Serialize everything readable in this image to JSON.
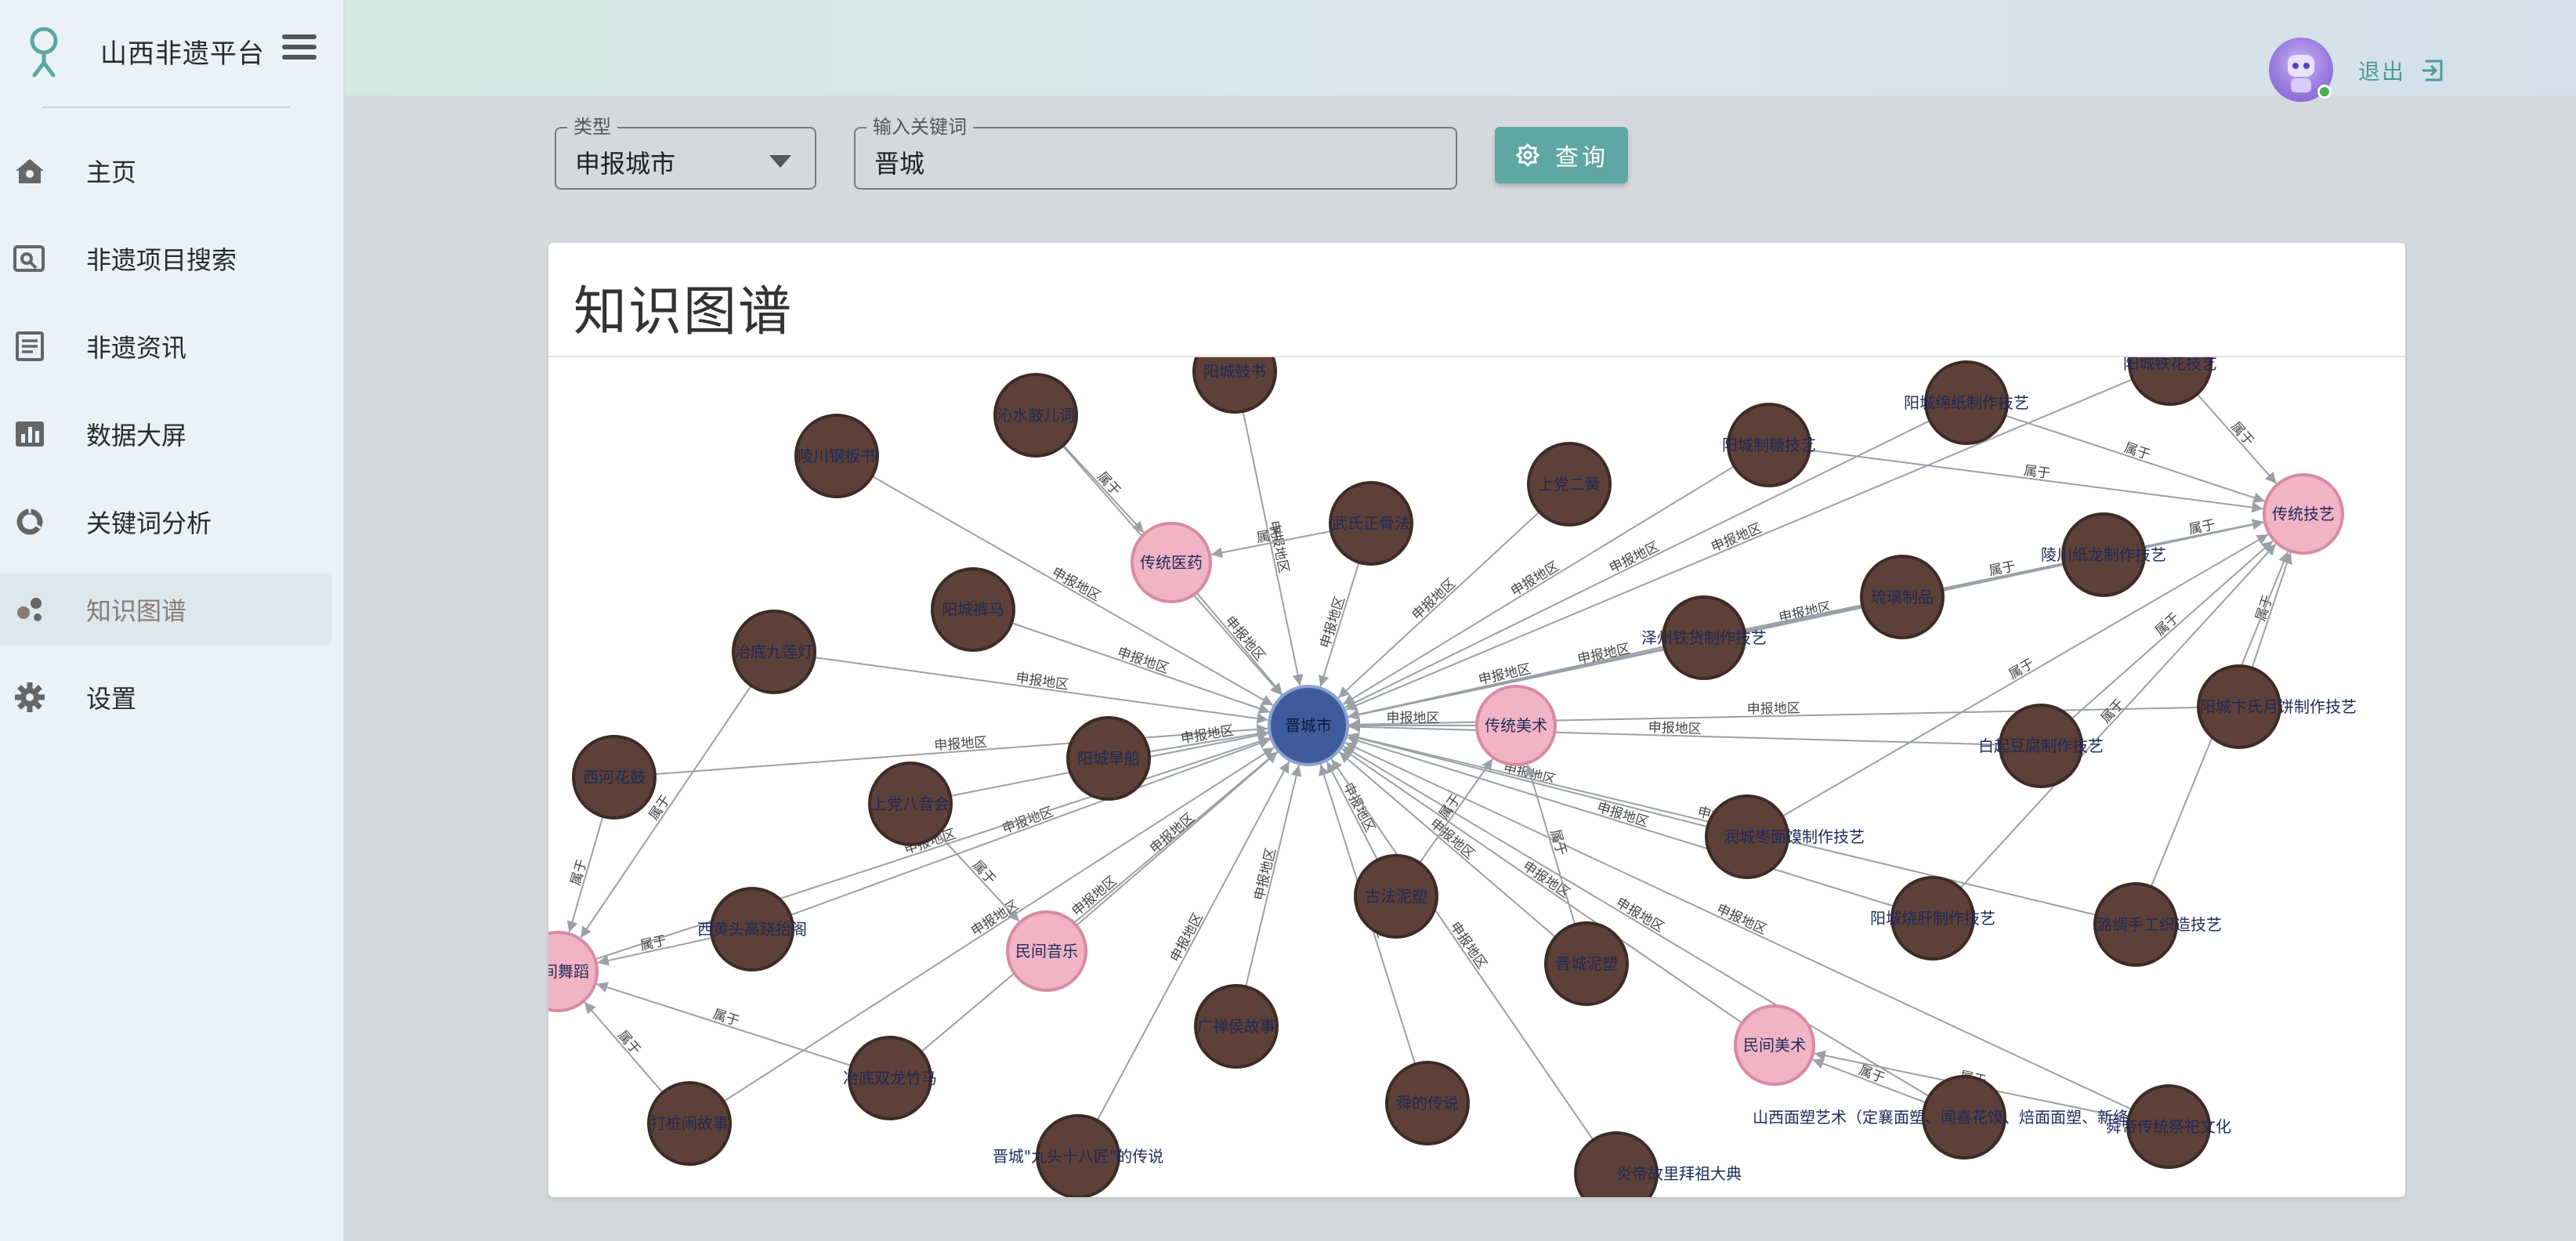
{
  "app": {
    "title": "山西非遗平台"
  },
  "nav": [
    {
      "key": "home",
      "label": "主页",
      "icon": "home-icon"
    },
    {
      "key": "search",
      "label": "非遗项目搜索",
      "icon": "image-search-icon"
    },
    {
      "key": "news",
      "label": "非遗资讯",
      "icon": "article-icon"
    },
    {
      "key": "dashboard",
      "label": "数据大屏",
      "icon": "bar-chart-icon"
    },
    {
      "key": "keyword",
      "label": "关键词分析",
      "icon": "donut-chart-icon"
    },
    {
      "key": "graph",
      "label": "知识图谱",
      "icon": "bubbles-icon",
      "active": true
    },
    {
      "key": "settings",
      "label": "设置",
      "icon": "gear-icon"
    }
  ],
  "header": {
    "logout_label": "退出"
  },
  "search": {
    "type_label": "类型",
    "type_value": "申报城市",
    "keyword_label": "输入关键词",
    "keyword_value": "晋城",
    "query_label": "查询"
  },
  "card": {
    "title": "知识图谱"
  },
  "colors": {
    "center_node": "#3e5b9c",
    "category_node": "#f1b4c5",
    "item_node": "#5d4037",
    "edge": "#9aa0a6",
    "accent": "#5fa7a3"
  },
  "graph": {
    "center": {
      "id": "c",
      "label": "晋城市"
    },
    "categories": [
      {
        "id": "k1",
        "label": "传统医药"
      },
      {
        "id": "k2",
        "label": "传统美术"
      },
      {
        "id": "k3",
        "label": "传统技艺"
      },
      {
        "id": "k4",
        "label": "民间音乐"
      },
      {
        "id": "k5",
        "label": "民间美术"
      },
      {
        "id": "k6",
        "label": "民间舞蹈"
      }
    ],
    "items": [
      {
        "id": "i1",
        "label": "阳城鼓书"
      },
      {
        "id": "i2",
        "label": "沁水鼓儿词"
      },
      {
        "id": "i3",
        "label": "陵川钢板书"
      },
      {
        "id": "i4",
        "label": "武氏正骨法"
      },
      {
        "id": "i5",
        "label": "上党二簧"
      },
      {
        "id": "i6",
        "label": "阳城制糖技艺"
      },
      {
        "id": "i7",
        "label": "阳城绵纸制作技艺"
      },
      {
        "id": "i8",
        "label": "阳城铁花技艺"
      },
      {
        "id": "i9",
        "label": "阳城裤马"
      },
      {
        "id": "i10",
        "label": "泽州铁货制作技艺"
      },
      {
        "id": "i11",
        "label": "琉璃制品"
      },
      {
        "id": "i12",
        "label": "陵川纸龙制作技艺"
      },
      {
        "id": "i13",
        "label": "冶底九莲灯"
      },
      {
        "id": "i14",
        "label": "西河花鼓"
      },
      {
        "id": "i15",
        "label": "上党八音会"
      },
      {
        "id": "i16",
        "label": "阳城旱船"
      },
      {
        "id": "i17",
        "label": "白起豆腐制作技艺"
      },
      {
        "id": "i18",
        "label": "阳城卞氏月饼制作技艺"
      },
      {
        "id": "i19",
        "label": "润城枣面馍制作技艺"
      },
      {
        "id": "i20",
        "label": "西黄头高跷抬阁"
      },
      {
        "id": "i21",
        "label": "古法泥塑"
      },
      {
        "id": "i22",
        "label": "晋城泥塑"
      },
      {
        "id": "i23",
        "label": "阳城烧肝制作技艺"
      },
      {
        "id": "i24",
        "label": "潞绸手工织造技艺"
      },
      {
        "id": "i25",
        "label": "广禅侯故事"
      },
      {
        "id": "i26",
        "label": "冶底双龙竹马"
      },
      {
        "id": "i27",
        "label": "打桩闹故事"
      },
      {
        "id": "i28",
        "label": "舜的传说"
      },
      {
        "id": "i29",
        "label": "晋城\"九头十八匠\"的传说"
      },
      {
        "id": "i30",
        "label": "炎帝故里拜祖大典"
      },
      {
        "id": "i31",
        "label": "山西面塑艺术（定襄面塑、闻喜花馍、焙面面塑、新绛面塑）"
      },
      {
        "id": "i32",
        "label": "舜帝传统祭祀文化"
      }
    ],
    "edge_labels": {
      "report": "申报地区",
      "belongs": "属于"
    }
  }
}
